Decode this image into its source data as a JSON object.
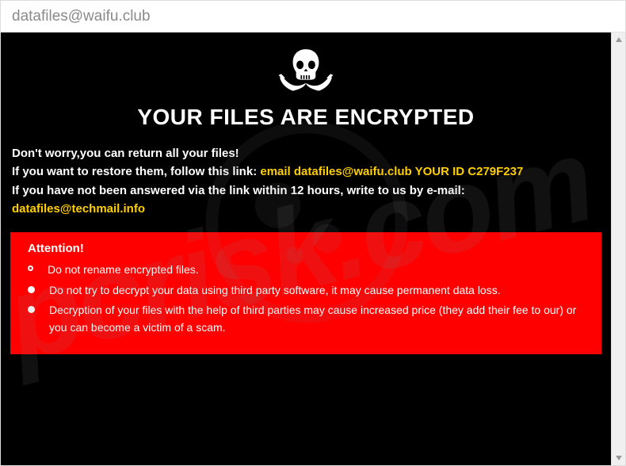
{
  "window": {
    "title": "datafiles@waifu.club"
  },
  "headline": "YOUR FILES ARE ENCRYPTED",
  "body": {
    "line1": "Don't worry,you can return all your files!",
    "line2_a": "If you want to restore them, follow this link: ",
    "line2_b": "email datafiles@waifu.club  YOUR ID ",
    "line2_id": "C279F237",
    "line3_a": "If you have not been answered via the link within 12 hours, write to us by e-mail: ",
    "line3_email": "datafiles@techmail.info"
  },
  "attention": {
    "title": "Attention!",
    "items": [
      "Do not rename encrypted files.",
      "Do not try to decrypt your data using third party software, it may cause permanent data loss.",
      "Decryption of your files with the help of third parties may cause increased price (they add their fee to our) or you can become a victim of a scam."
    ]
  },
  "watermark": "pcrisk.com"
}
